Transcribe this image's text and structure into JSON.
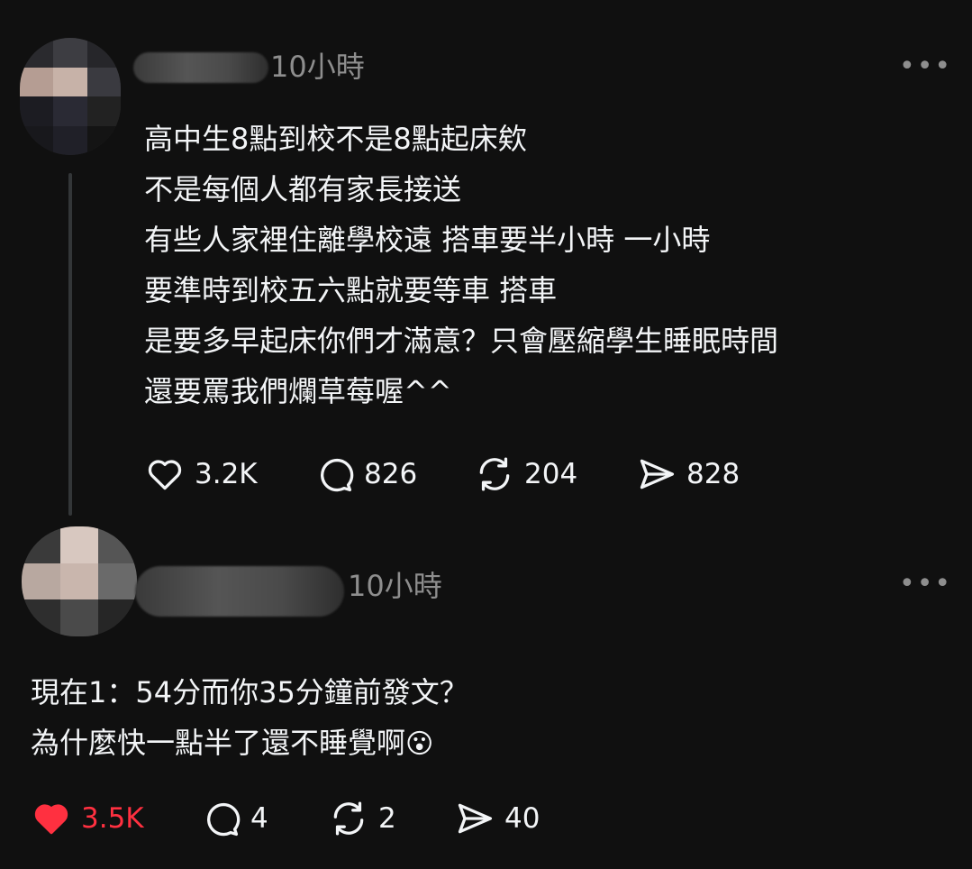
{
  "post": {
    "time": "10小時",
    "more": "•••",
    "lines": [
      "高中生8點到校不是8點起床欸",
      "不是每個人都有家長接送",
      "有些人家裡住離學校遠 搭車要半小時 一小時",
      "要準時到校五六點就要等車 搭車",
      "是要多早起床你們才滿意？只會壓縮學生睡眠時間",
      "還要罵我們爛草莓喔^^"
    ],
    "actions": {
      "likes": "3.2K",
      "comments": "826",
      "reposts": "204",
      "shares": "828"
    }
  },
  "reply": {
    "time": "10小時",
    "more": "•••",
    "lines": [
      "現在1：54分而你35分鐘前發文？",
      "為什麼快一點半了還不睡覺啊"
    ],
    "emoji": "😮",
    "actions": {
      "likes": "3.5K",
      "comments": "4",
      "reposts": "2",
      "shares": "40"
    }
  },
  "colors": {
    "background": "#101010",
    "text": "#f3f5f7",
    "muted": "#8e8e8e",
    "like_active": "#ff3040"
  }
}
